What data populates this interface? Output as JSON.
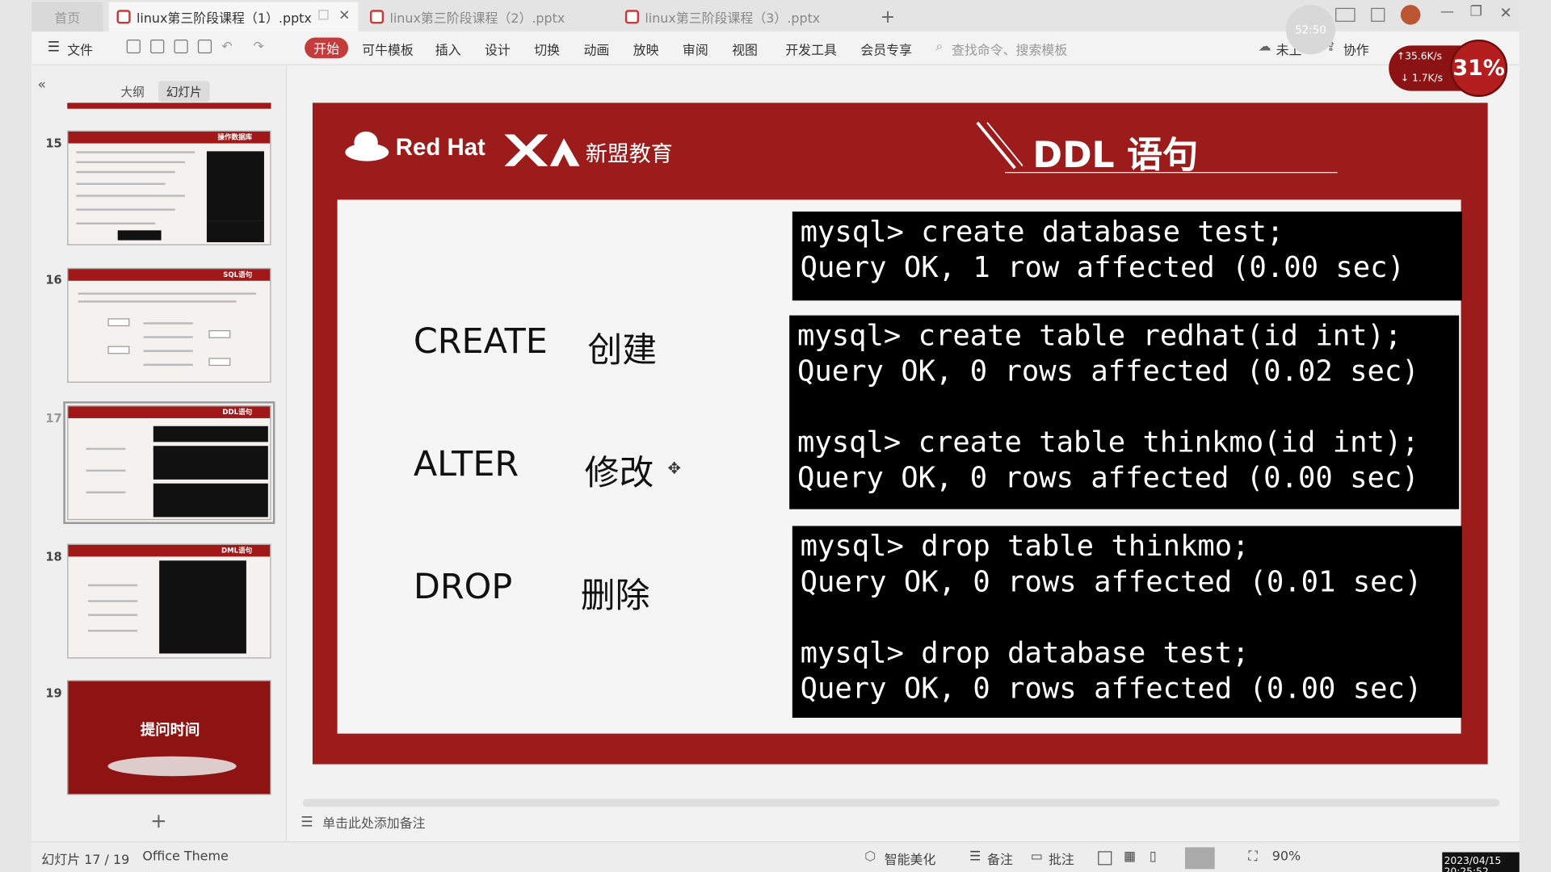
{
  "tabs": {
    "home": "首页",
    "t1": "linux第三阶段课程（1）.pptx",
    "t2": "linux第三阶段课程（2）.pptx",
    "t3": "linux第三阶段课程（3）.pptx",
    "new_tab": "+"
  },
  "ribbon": {
    "file": "文件",
    "start": "开始",
    "template": "可牛模板",
    "insert": "插入",
    "design": "设计",
    "transition": "切换",
    "animation": "动画",
    "slideshow": "放映",
    "review": "审阅",
    "view": "视图",
    "devtools": "开发工具",
    "member": "会员专享",
    "search": "查找命令、搜索模板",
    "cloud": "未上",
    "collab": "协作"
  },
  "panel": {
    "outline": "大纲",
    "slides": "幻灯片",
    "numbers": [
      "15",
      "16",
      "17",
      "18",
      "19"
    ],
    "add": "+",
    "thumb19_title": "提问时间",
    "thumb15_title": "操作数据库",
    "thumb16_title": "SQL语句",
    "thumb17_title": "DDL语句",
    "thumb18_title": "DML语句"
  },
  "slide": {
    "brand": "Red Hat",
    "partner": "新盟教育",
    "title": "DDL 语句",
    "commands": [
      {
        "kw": "CREATE",
        "cn": "创建"
      },
      {
        "kw": "ALTER",
        "cn": "修改"
      },
      {
        "kw": "DROP",
        "cn": "删除"
      }
    ],
    "term1": "mysql> create database test;\nQuery OK, 1 row affected (0.00 sec)",
    "term2": "mysql> create table redhat(id int);\nQuery OK, 0 rows affected (0.02 sec)\n\nmysql> create table thinkmo(id int);\nQuery OK, 0 rows affected (0.00 sec)",
    "term3": "mysql> drop table thinkmo;\nQuery OK, 0 rows affected (0.01 sec)\n\nmysql> drop database test;\nQuery OK, 0 rows affected (0.00 sec)"
  },
  "notes_placeholder": "单击此处添加备注",
  "status": {
    "slide_count": "幻灯片 17 / 19",
    "theme": "Office Theme",
    "smart": "智能美化",
    "notes": "备注",
    "comments": "批注",
    "zoom": "90%"
  },
  "overlay": {
    "clock": "52:50",
    "net_up": "↑35.6K/s",
    "net_down": "↓ 1.7K/s",
    "net_pct": "31%",
    "datetime": "2023/04/15 20:25:52"
  },
  "colors": {
    "accent": "#c43b3b",
    "slide_red": "#9c1c1c"
  }
}
